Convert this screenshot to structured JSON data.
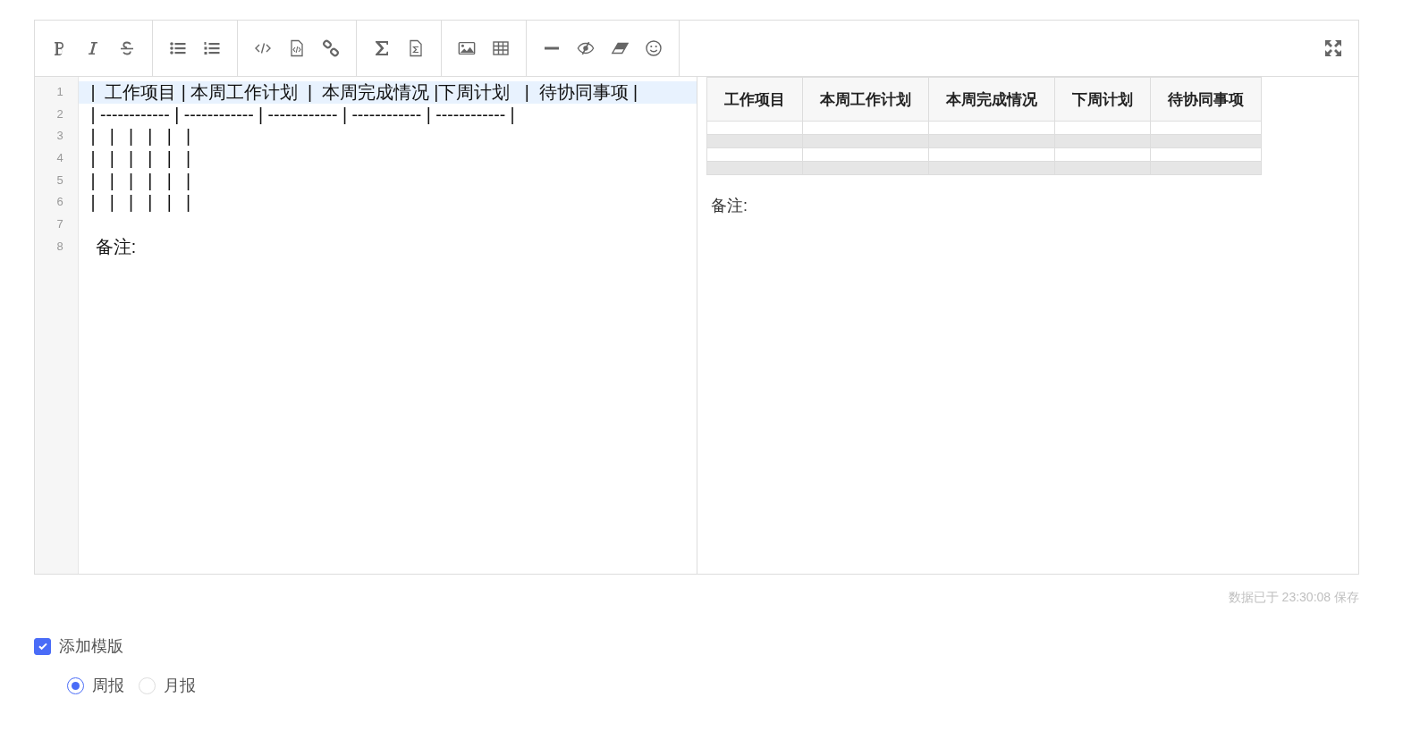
{
  "editor": {
    "lines": [
      {
        "number": "1",
        "text": " |  工作项目 | 本周工作计划  |  本周完成情况 |下周计划   |  待协同事项 |",
        "active": true
      },
      {
        "number": "2",
        "text": " | ------------ | ------------ | ------------ | ------------ | ------------ |",
        "active": false
      },
      {
        "number": "3",
        "text": " |   |   |   |   |   |",
        "active": false
      },
      {
        "number": "4",
        "text": " |   |   |   |   |   |",
        "active": false
      },
      {
        "number": "5",
        "text": " |   |   |   |   |   |",
        "active": false
      },
      {
        "number": "6",
        "text": " |   |   |   |   |   |",
        "active": false
      },
      {
        "number": "7",
        "active": false
      },
      {
        "number": "8",
        "text": "  备注:",
        "active": false
      }
    ]
  },
  "preview": {
    "table": {
      "columns": [
        "工作项目",
        "本周工作计划",
        "本周完成情况",
        "下周计划",
        "待协同事项"
      ],
      "rows": [
        {
          "shaded": false
        },
        {
          "shaded": true
        },
        {
          "shaded": false
        },
        {
          "shaded": true
        }
      ]
    },
    "note": "备注:"
  },
  "save_status": "数据已于 23:30:08 保存",
  "template_checkbox": {
    "label": "添加模版",
    "checked": true
  },
  "report_type": [
    {
      "label": "周报",
      "selected": true
    },
    {
      "label": "月报",
      "selected": false
    }
  ]
}
